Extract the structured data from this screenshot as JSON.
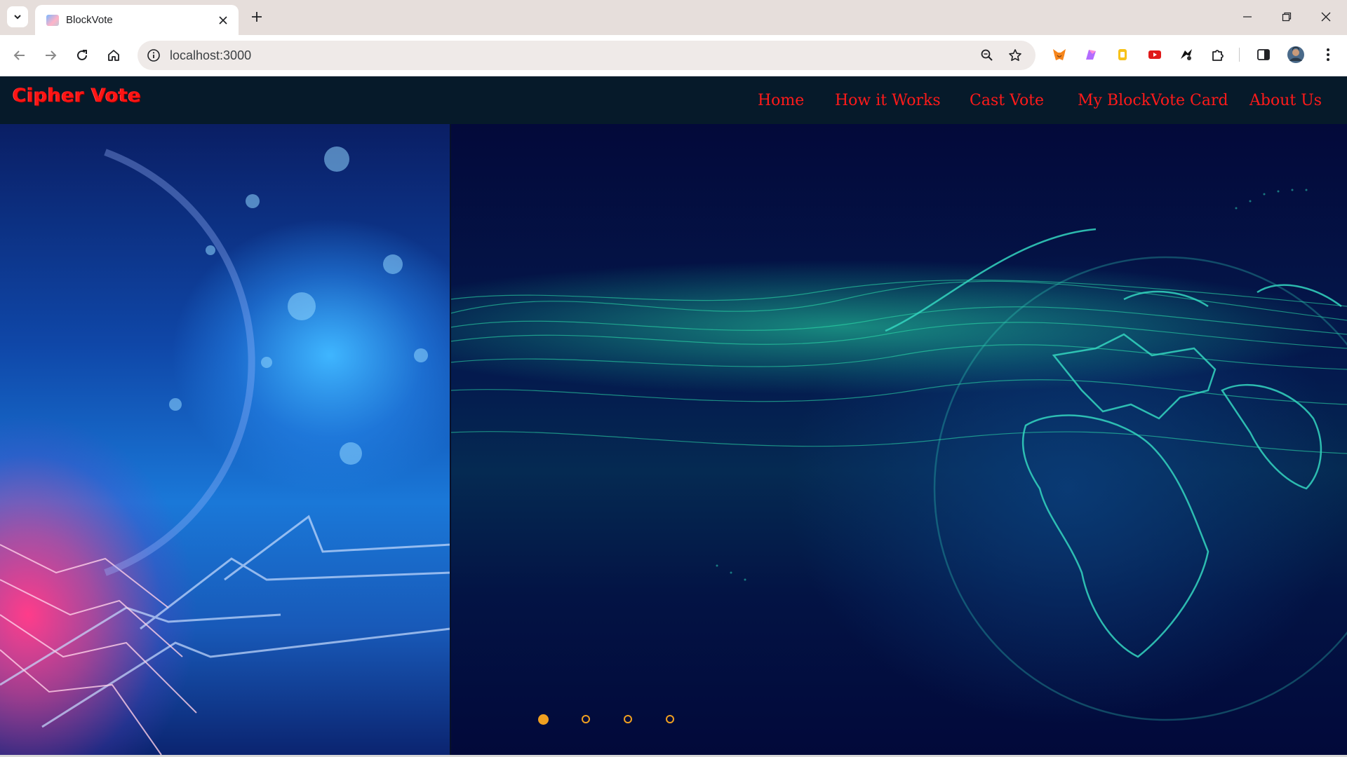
{
  "browser": {
    "tab_title": "BlockVote",
    "url": "localhost:3000",
    "icons": {
      "tab_search": "chevron-down-icon",
      "tab_close": "close-icon",
      "new_tab": "plus-icon",
      "back": "back-arrow-icon",
      "forward": "forward-arrow-icon",
      "reload": "reload-icon",
      "home": "home-icon",
      "site_info": "info-icon",
      "zoom": "zoom-icon",
      "bookmark": "star-icon",
      "extensions": [
        "metamask-fox-icon",
        "purple-extension-icon",
        "yellow-extension-icon",
        "youtube-icon",
        "black-extension-icon",
        "puzzle-icon"
      ],
      "side_panel": "side-panel-icon",
      "profile": "avatar",
      "menu": "kebab-menu-icon"
    }
  },
  "site": {
    "logo": "Cipher Vote",
    "nav": [
      {
        "label": "Home"
      },
      {
        "label": "How it Works"
      },
      {
        "label": "Cast Vote"
      },
      {
        "label": "My BlockVote Card"
      },
      {
        "label": "About Us"
      }
    ],
    "colors": {
      "nav_bg": "#061a2a",
      "nav_text": "#ff1a1a",
      "logo": "#ff1414",
      "dot_accent": "#f0a020"
    }
  },
  "carousel": {
    "slide_count": 4,
    "active_index": 0
  }
}
